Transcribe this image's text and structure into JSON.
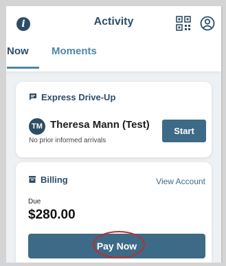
{
  "header": {
    "title": "Activity",
    "icons": [
      "info-icon",
      "qr-code-icon",
      "profile-icon"
    ]
  },
  "tabs": [
    {
      "label": "Now",
      "active": true
    },
    {
      "label": "Moments",
      "active": false
    }
  ],
  "drive_up": {
    "title": "Express Drive-Up",
    "icon": "chat-bubble-icon",
    "avatar_initials": "TM",
    "name": "Theresa Mann (Test)",
    "subtext": "No prior informed arrivals",
    "start_label": "Start"
  },
  "billing": {
    "title": "Billing",
    "icon": "billing-icon",
    "view_account_label": "View Account",
    "due_label": "Due",
    "amount": "$280.00",
    "pay_label": "Pay Now"
  },
  "colors": {
    "primary": "#2c4d66",
    "accent": "#3d6a86",
    "tab_inactive": "#4d86a8",
    "annotation_ring": "#c32a2a"
  }
}
